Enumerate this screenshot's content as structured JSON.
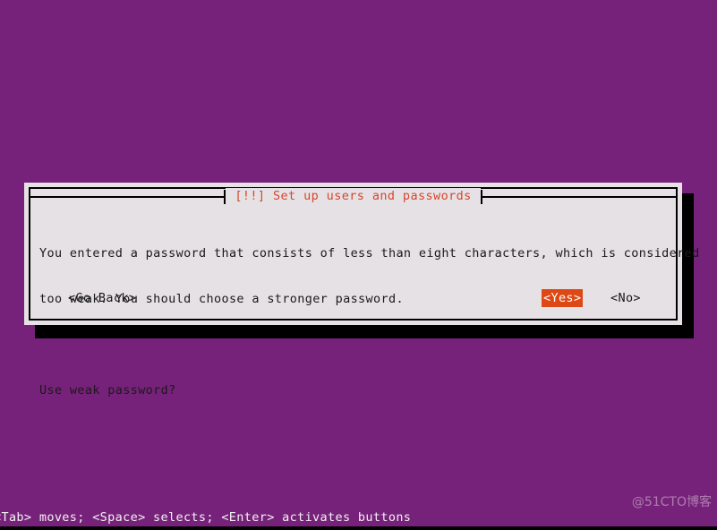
{
  "screen": {
    "background_color": "#77227a",
    "bottom_bar_color": "#000000"
  },
  "dialog": {
    "title": "[!!] Set up users and passwords",
    "title_color": "#d4472a",
    "background_color": "#e6e1e5",
    "border_color": "#000000",
    "shadow_color": "#000000",
    "body_lines": [
      "You entered a password that consists of less than eight characters, which is considered",
      "too weak. You should choose a stronger password."
    ],
    "question": "Use weak password?",
    "buttons": [
      {
        "label": "<Go Back>",
        "selected": false
      },
      {
        "label": "<Yes>",
        "selected": true
      },
      {
        "label": "<No>",
        "selected": false
      }
    ],
    "selected_color": "#dd4814",
    "selected_text_color": "#ffffff"
  },
  "help": {
    "text": "<Tab> moves; <Space> selects; <Enter> activates buttons",
    "color": "#f2f2f2"
  },
  "watermark": {
    "text": "@51CTO博客"
  }
}
